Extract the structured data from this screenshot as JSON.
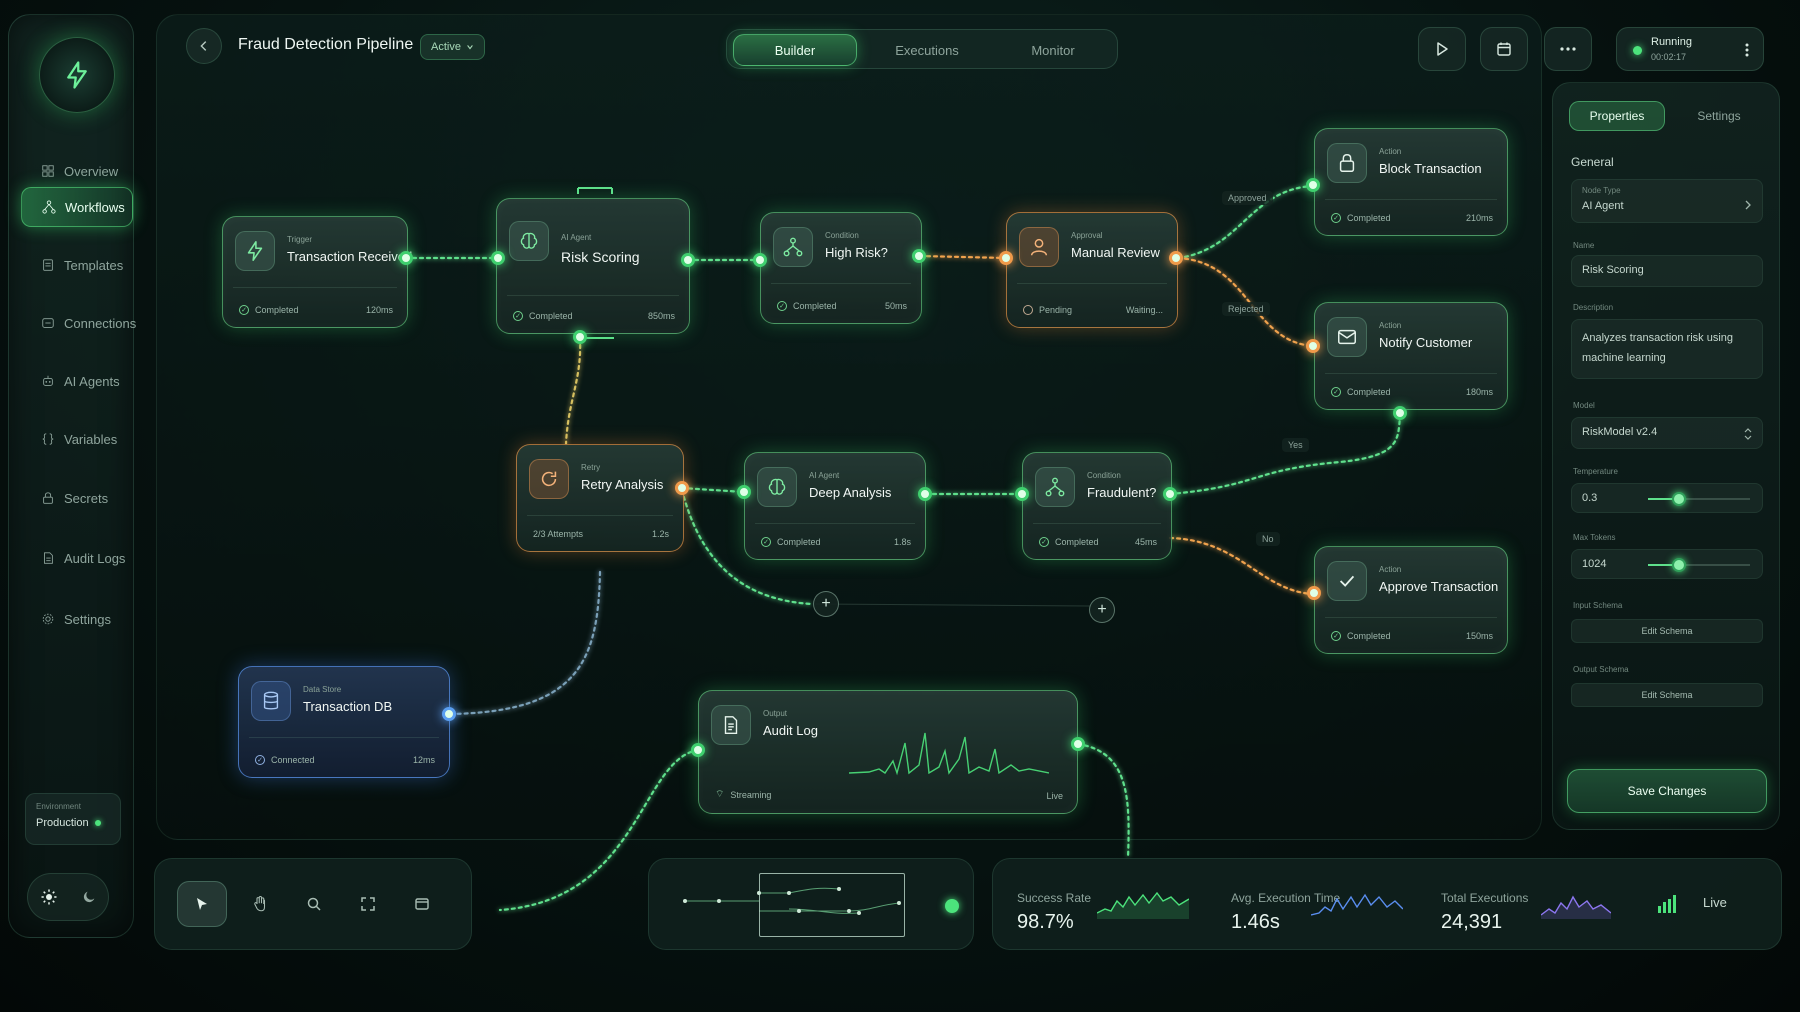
{
  "app": {
    "title": "Fraud Detection Pipeline",
    "status_badge": "Active"
  },
  "sidebar": {
    "items": [
      {
        "label": "Overview",
        "icon": "grid-icon"
      },
      {
        "label": "Workflows",
        "icon": "workflow-icon",
        "active": true
      },
      {
        "label": "Templates",
        "icon": "template-icon"
      },
      {
        "label": "Connections",
        "icon": "connections-icon"
      },
      {
        "label": "AI Agents",
        "icon": "robot-icon"
      },
      {
        "label": "Variables",
        "icon": "braces-icon"
      },
      {
        "label": "Secrets",
        "icon": "lock-icon"
      },
      {
        "label": "Audit Logs",
        "icon": "document-icon"
      },
      {
        "label": "Settings",
        "icon": "gear-icon"
      }
    ],
    "environment": {
      "label": "Environment",
      "value": "Production"
    }
  },
  "tabs": [
    "Builder",
    "Executions",
    "Monitor"
  ],
  "run": {
    "status": "Running",
    "elapsed": "00:02:17"
  },
  "nodes": {
    "trigger": {
      "type": "Trigger",
      "name": "Transaction Received",
      "status": "Completed",
      "time": "120ms"
    },
    "risk": {
      "type": "AI Agent",
      "name": "Risk Scoring",
      "status": "Completed",
      "time": "850ms"
    },
    "high_risk": {
      "type": "Condition",
      "name": "High Risk?",
      "status": "Completed",
      "time": "50ms"
    },
    "review": {
      "type": "Approval",
      "name": "Manual Review",
      "status": "Pending",
      "time": "Waiting..."
    },
    "block": {
      "type": "Action",
      "name": "Block Transaction",
      "status": "Completed",
      "time": "210ms"
    },
    "notify": {
      "type": "Action",
      "name": "Notify Customer",
      "status": "Completed",
      "time": "180ms"
    },
    "retry": {
      "type": "Retry",
      "name": "Retry Analysis",
      "status": "2/3 Attempts",
      "time": "1.2s"
    },
    "deep": {
      "type": "AI Agent",
      "name": "Deep Analysis",
      "status": "Completed",
      "time": "1.8s"
    },
    "fraud": {
      "type": "Condition",
      "name": "Fraudulent?",
      "status": "Completed",
      "time": "45ms"
    },
    "approve": {
      "type": "Action",
      "name": "Approve Transaction",
      "status": "Completed",
      "time": "150ms"
    },
    "db": {
      "type": "Data Store",
      "name": "Transaction DB",
      "status": "Connected",
      "time": "12ms"
    },
    "audit": {
      "type": "Output",
      "name": "Audit Log",
      "status": "Streaming",
      "time": "Live"
    }
  },
  "edge_labels": {
    "approved": "Approved",
    "rejected": "Rejected",
    "yes": "Yes",
    "no": "No"
  },
  "properties": {
    "tabs": [
      "Properties",
      "Settings"
    ],
    "section": "General",
    "node_type_label": "Node Type",
    "node_type": "AI Agent",
    "name_label": "Name",
    "name": "Risk Scoring",
    "description_label": "Description",
    "description": "Analyzes transaction risk using machine learning",
    "model_label": "Model",
    "model": "RiskModel v2.4",
    "temperature_label": "Temperature",
    "temperature": "0.3",
    "temperature_fraction": 0.3,
    "max_tokens_label": "Max Tokens",
    "max_tokens": "1024",
    "max_tokens_fraction": 0.3,
    "input_schema_label": "Input Schema",
    "output_schema_label": "Output Schema",
    "edit_schema": "Edit Schema",
    "save": "Save Changes"
  },
  "stats": {
    "success_label": "Success Rate",
    "success_value": "98.7%",
    "avg_label": "Avg. Execution Time",
    "avg_value": "1.46s",
    "total_label": "Total Executions",
    "total_value": "24,391",
    "live": "Live"
  },
  "colors": {
    "accent": "#4ce37c",
    "warning": "#f09a4a",
    "info": "#5a9ef0"
  }
}
